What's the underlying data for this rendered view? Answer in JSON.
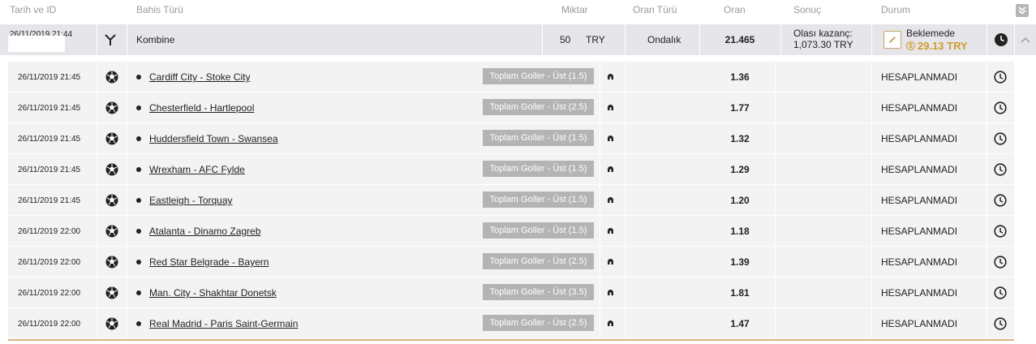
{
  "header": {
    "date_id": "Tarih ve ID",
    "bet_type": "Bahis Türü",
    "amount": "Miktar",
    "odds_type": "Oran Türü",
    "odds": "Oran",
    "result": "Sonuç",
    "status": "Durum",
    "expand_icon": "double-chevron-down-icon"
  },
  "bet": {
    "datetime": "26/11/2019 21:44",
    "type": "Kombine",
    "amount": "50",
    "currency": "TRY",
    "odds_type": "Ondalık",
    "odds": "21.465",
    "potential_label": "Olası kazanç:",
    "potential_value": "1,073.30 TRY",
    "status_label": "Beklemede",
    "status_amount": "29.13 TRY",
    "coin_symbol": "$",
    "colors": {
      "accent": "#d09a2c",
      "row_bg": "#e6e6ea",
      "sel_bg": "#f3f3f3",
      "market_bg": "#b4b4b4"
    }
  },
  "selections": [
    {
      "datetime": "26/11/2019 21:45",
      "match": "Cardiff City - Stoke City",
      "market": "Toplam Goller - Üst (1.5)",
      "odds": "1.36",
      "status": "HESAPLANMADI"
    },
    {
      "datetime": "26/11/2019 21:45",
      "match": "Chesterfield - Hartlepool",
      "market": "Toplam Goller - Üst (2.5)",
      "odds": "1.77",
      "status": "HESAPLANMADI"
    },
    {
      "datetime": "26/11/2019 21:45",
      "match": "Huddersfield Town - Swansea",
      "market": "Toplam Goller - Üst (1.5)",
      "odds": "1.32",
      "status": "HESAPLANMADI"
    },
    {
      "datetime": "26/11/2019 21:45",
      "match": "Wrexham - AFC Fylde",
      "market": "Toplam Goller - Üst (1.5)",
      "odds": "1.29",
      "status": "HESAPLANMADI"
    },
    {
      "datetime": "26/11/2019 21:45",
      "match": "Eastleigh - Torquay",
      "market": "Toplam Goller - Üst (1.5)",
      "odds": "1.20",
      "status": "HESAPLANMADI"
    },
    {
      "datetime": "26/11/2019 22:00",
      "match": "Atalanta - Dinamo Zagreb",
      "market": "Toplam Goller - Üst (1.5)",
      "odds": "1.18",
      "status": "HESAPLANMADI"
    },
    {
      "datetime": "26/11/2019 22:00",
      "match": "Red Star Belgrade - Bayern",
      "market": "Toplam Goller - Üst (2.5)",
      "odds": "1.39",
      "status": "HESAPLANMADI"
    },
    {
      "datetime": "26/11/2019 22:00",
      "match": "Man. City - Shakhtar Donetsk",
      "market": "Toplam Goller - Üst (3.5)",
      "odds": "1.81",
      "status": "HESAPLANMADI"
    },
    {
      "datetime": "26/11/2019 22:00",
      "match": "Real Madrid - Paris Saint-Germain",
      "market": "Toplam Goller - Üst (2.5)",
      "odds": "1.47",
      "status": "HESAPLANMADI"
    }
  ]
}
